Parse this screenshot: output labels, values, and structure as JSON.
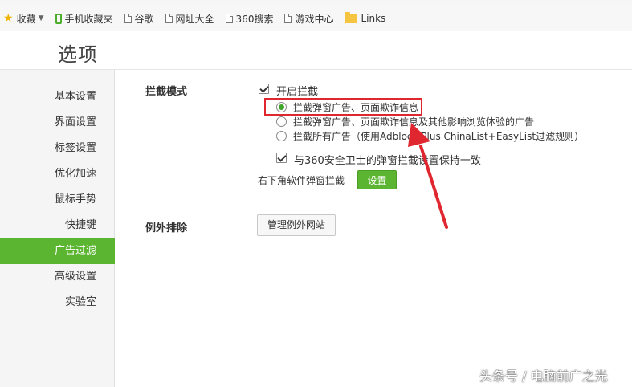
{
  "bookmarks": [
    {
      "label": "收藏",
      "icon": "star-icon",
      "has_dropdown": true
    },
    {
      "label": "手机收藏夹",
      "icon": "phone-icon"
    },
    {
      "label": "谷歌",
      "icon": "page-icon"
    },
    {
      "label": "网址大全",
      "icon": "page-icon"
    },
    {
      "label": "360搜索",
      "icon": "page-icon"
    },
    {
      "label": "游戏中心",
      "icon": "page-icon"
    },
    {
      "label": "Links",
      "icon": "folder-icon"
    }
  ],
  "page_title": "选项",
  "sidebar": {
    "items": [
      {
        "label": "基本设置"
      },
      {
        "label": "界面设置"
      },
      {
        "label": "标签设置"
      },
      {
        "label": "优化加速"
      },
      {
        "label": "鼠标手势"
      },
      {
        "label": "快捷键"
      },
      {
        "label": "广告过滤",
        "active": true
      },
      {
        "label": "高级设置"
      },
      {
        "label": "实验室"
      }
    ]
  },
  "intercept": {
    "section_label": "拦截模式",
    "enable_label": "开启拦截",
    "enable_checked": true,
    "options": [
      {
        "label": "拦截弹窗广告、页面欺诈信息",
        "checked": true
      },
      {
        "label": "拦截弹窗广告、页面欺诈信息及其他影响浏览体验的广告",
        "checked": false
      },
      {
        "label": "拦截所有广告（使用Adblock Plus ChinaList+EasyList过滤规则）",
        "checked": false
      }
    ],
    "sync_label": "与360安全卫士的弹窗拦截设置保持一致",
    "sync_checked": true,
    "corner_popup_label": "右下角软件弹窗拦截",
    "settings_button": "设置"
  },
  "exceptions": {
    "section_label": "例外排除",
    "manage_button": "管理例外网站"
  },
  "colors": {
    "accent_green": "#5bb530",
    "annotation_red": "#e0262e"
  },
  "watermark": "头条号 / 电脑前广之光"
}
